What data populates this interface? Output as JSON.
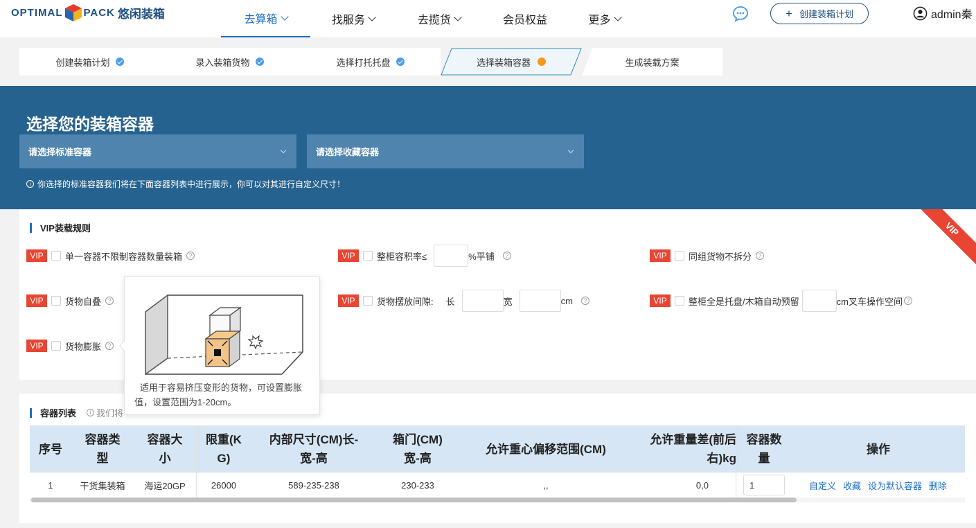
{
  "logo": {
    "text_left": "OPTIMAL",
    "text_right": "PACK",
    "cn": "悠闲装箱"
  },
  "nav": {
    "items": [
      {
        "label": "去算箱",
        "has_dropdown": true,
        "active": true
      },
      {
        "label": "找服务",
        "has_dropdown": true,
        "active": false
      },
      {
        "label": "去揽货",
        "has_dropdown": true,
        "active": false
      },
      {
        "label": "会员权益",
        "has_dropdown": false,
        "active": false
      },
      {
        "label": "更多",
        "has_dropdown": true,
        "active": false
      }
    ],
    "create_button": "创建装箱计划",
    "user": "admin秦"
  },
  "steps": [
    {
      "label": "创建装箱计划",
      "status": "done"
    },
    {
      "label": "录入装箱货物",
      "status": "done"
    },
    {
      "label": "选择打托托盘",
      "status": "done"
    },
    {
      "label": "选择装箱容器",
      "status": "current"
    },
    {
      "label": "生成装载方案",
      "status": "pending"
    }
  ],
  "banner": {
    "title": "选择您的装箱容器",
    "standard_select": "请选择标准容器",
    "favorite_select": "请选择收藏容器",
    "note": "你选择的标准容器我们将在下面容器列表中进行展示，你可以对其进行自定义尺寸！"
  },
  "vip_rules": {
    "title": "VIP装载规则",
    "corner": "VIP",
    "badge": "VIP",
    "r1": "单一容器不限制容器数量装箱",
    "r2_pre": "整柜容积率≤",
    "r2_post": "%平铺",
    "r3": "同组货物不拆分",
    "r4": "货物自叠",
    "r5_pre": "货物摆放间隙:",
    "r5_len": "长",
    "r5_wid": "宽",
    "r5_unit": "cm",
    "r6_pre": "整柜全是托盘/木箱自动预留",
    "r6_post": "cm叉车操作空间",
    "r7": "货物膨胀"
  },
  "tooltip": {
    "text": "适用于容易挤压变形的货物，可设置膨胀值，设置范围为1-20cm。"
  },
  "container_list": {
    "title": "容器列表",
    "note": "我们将",
    "headers": [
      "序号",
      "容器类型",
      "容器大小",
      "限重(KG)",
      "内部尺寸(CM)长-宽-高",
      "箱门(CM)宽-高",
      "允许重心偏移范围(CM)",
      "允许重量差(前后左右)kg",
      "容器数量",
      "操作"
    ],
    "header_lines": [
      [
        "序号"
      ],
      [
        "容器类",
        "型"
      ],
      [
        "容器大",
        "小"
      ],
      [
        "限重(K",
        "G)"
      ],
      [
        "内部尺寸(CM)长-",
        "宽-高"
      ],
      [
        "箱门(CM)",
        "宽-高"
      ],
      [
        "允许重心偏移范围(CM)"
      ],
      [
        "允许重量差(前后",
        "右)kg"
      ],
      [
        "容器数",
        "量"
      ],
      [
        "操作"
      ]
    ],
    "rows": [
      {
        "index": "1",
        "type": "干货集装箱",
        "size": "海运20GP",
        "weight": "26000",
        "inner": "589-235-238",
        "door": "230-233",
        "offset": ",,",
        "weight_diff": "0,0",
        "qty": "1",
        "ops": [
          "自定义",
          "收藏",
          "设为默认容器",
          "删除"
        ]
      }
    ]
  },
  "colors": {
    "brand": "#1f4f80",
    "accent": "#1d6fc4",
    "banner": "#26628f",
    "select_bg": "#4f84ae",
    "vip": "#e84533",
    "step_done": "#4a9de8",
    "step_current": "#f29b1a"
  }
}
